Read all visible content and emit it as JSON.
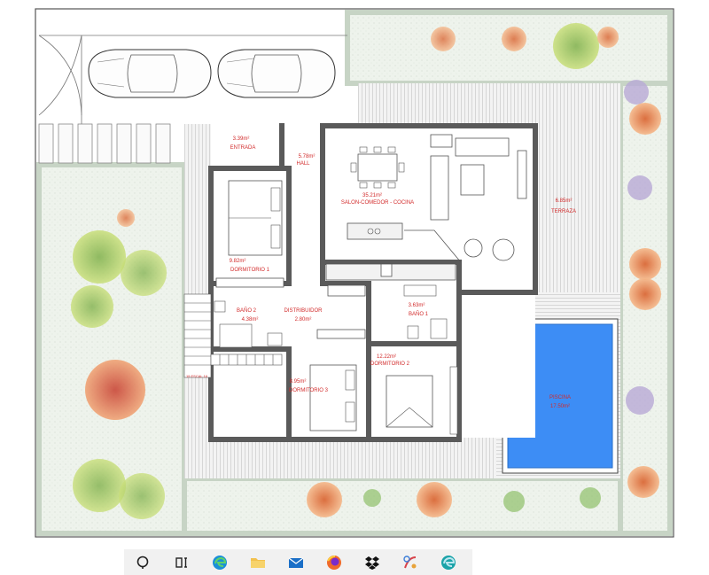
{
  "rooms": {
    "entrada": {
      "area": "3.39m²",
      "name": "ENTRADA"
    },
    "hall": {
      "area": "5.78m²",
      "name": "HALL"
    },
    "salon": {
      "area": "35.21m²",
      "name": "SALON-COMEDOR - COCINA"
    },
    "terraza": {
      "area": "6.85m²",
      "name": "TERRAZA"
    },
    "dormitorio1": {
      "area": "9.82m²",
      "name": "DORMITORIO 1"
    },
    "bano2": {
      "name": "BAÑO 2",
      "area": "4.38m²"
    },
    "distribuidor": {
      "name": "DISTRIBUIDOR",
      "area": "2.80m²"
    },
    "bano1": {
      "area": "3.63m²",
      "name": "BAÑO 1"
    },
    "dormitorio2": {
      "area": "12.22m²",
      "name": "DORMITORIO 2"
    },
    "dormitorio3": {
      "area": "8.95m²",
      "name": "DORMITORIO 3"
    },
    "piscina": {
      "name": "PISCINA",
      "area": "17.50m²"
    }
  },
  "stairs": {
    "label": "19 ESCAL 16"
  },
  "colors": {
    "wall": "#5a5a5a",
    "label": "#d22b2b",
    "pool": "#3d8df5",
    "deck": "#d9d9d9",
    "garden": "#e8efe6",
    "taskbar": "#f1f1f1"
  },
  "taskbar": {
    "items": [
      {
        "icon": "search-icon"
      },
      {
        "icon": "task-view-icon"
      },
      {
        "icon": "edge-icon"
      },
      {
        "icon": "file-explorer-icon"
      },
      {
        "icon": "mail-icon"
      },
      {
        "icon": "firefox-icon"
      },
      {
        "icon": "dropbox-icon"
      },
      {
        "icon": "paint-icon"
      },
      {
        "icon": "edge-beta-icon"
      }
    ]
  }
}
